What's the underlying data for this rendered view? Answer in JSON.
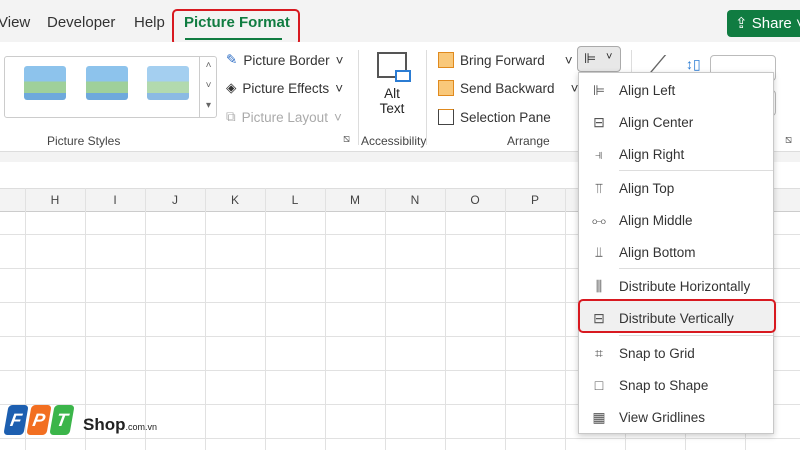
{
  "tabs": {
    "items": [
      "View",
      "Developer",
      "Help",
      "Picture Format"
    ],
    "active": "Picture Format",
    "share_label": "Share"
  },
  "ribbon": {
    "picture_styles": {
      "label": "Picture Styles",
      "buttons": [
        "Picture Border",
        "Picture Effects",
        "Picture Layout"
      ]
    },
    "accessibility": {
      "label": "Accessibility",
      "alt_text_line1": "Alt",
      "alt_text_line2": "Text"
    },
    "arrange": {
      "label": "Arrange",
      "buttons": [
        "Bring Forward",
        "Send Backward",
        "Selection Pane"
      ]
    }
  },
  "sheet": {
    "columns": [
      "H",
      "I",
      "J",
      "K",
      "L",
      "M",
      "N",
      "O",
      "P"
    ]
  },
  "align_menu": {
    "items": [
      "Align Left",
      "Align Center",
      "Align Right",
      "Align Top",
      "Align Middle",
      "Align Bottom",
      "Distribute Horizontally",
      "Distribute Vertically",
      "Snap to Grid",
      "Snap to Shape",
      "View Gridlines"
    ],
    "highlighted": "Distribute Vertically"
  },
  "logo": {
    "letters": [
      "F",
      "P",
      "T"
    ],
    "text": "Shop",
    "suffix": ".com.vn"
  },
  "colors": {
    "accent": "#107c41",
    "highlight": "#d81920"
  }
}
